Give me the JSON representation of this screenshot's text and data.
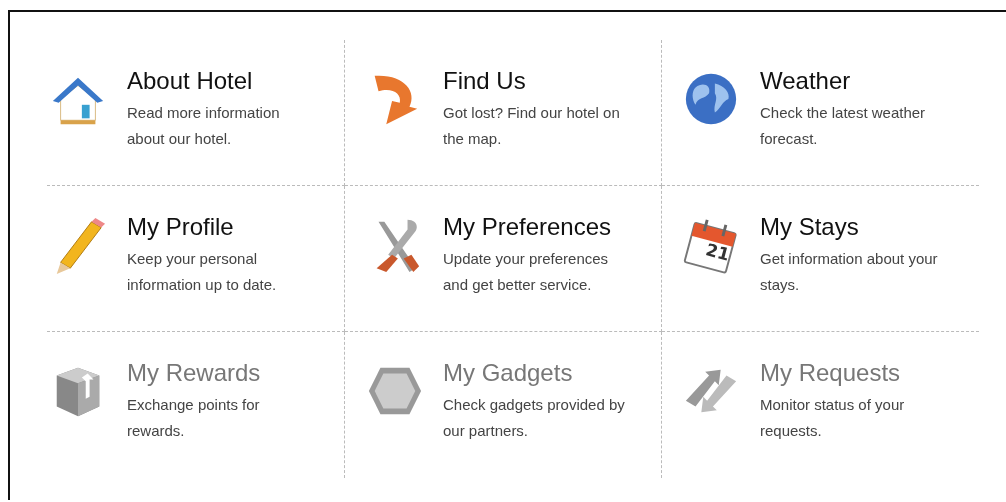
{
  "tiles": [
    {
      "kind": "house",
      "title": "About Hotel",
      "description": "Read more information about our hotel.",
      "disabled": false
    },
    {
      "kind": "arrow",
      "title": "Find Us",
      "description": "Got lost? Find our hotel on the map.",
      "disabled": false
    },
    {
      "kind": "globe",
      "title": "Weather",
      "description": "Check the latest weather forecast.",
      "disabled": false
    },
    {
      "kind": "pencil",
      "title": "My Profile",
      "description": "Keep your personal information up to date.",
      "disabled": false
    },
    {
      "kind": "tools",
      "title": "My Preferences",
      "description": "Update your preferences and get better service.",
      "disabled": false
    },
    {
      "kind": "calendar",
      "title": "My Stays",
      "description": "Get information about your stays.",
      "disabled": false
    },
    {
      "kind": "box",
      "title": "My Rewards",
      "description": "Exchange points for rewards.",
      "disabled": true
    },
    {
      "kind": "hexagon",
      "title": "My Gadgets",
      "description": "Check gadgets provided by our partners.",
      "disabled": true
    },
    {
      "kind": "arrows",
      "title": "My Requests",
      "description": "Monitor status of your requests.",
      "disabled": true
    }
  ],
  "calendar_day": "21"
}
